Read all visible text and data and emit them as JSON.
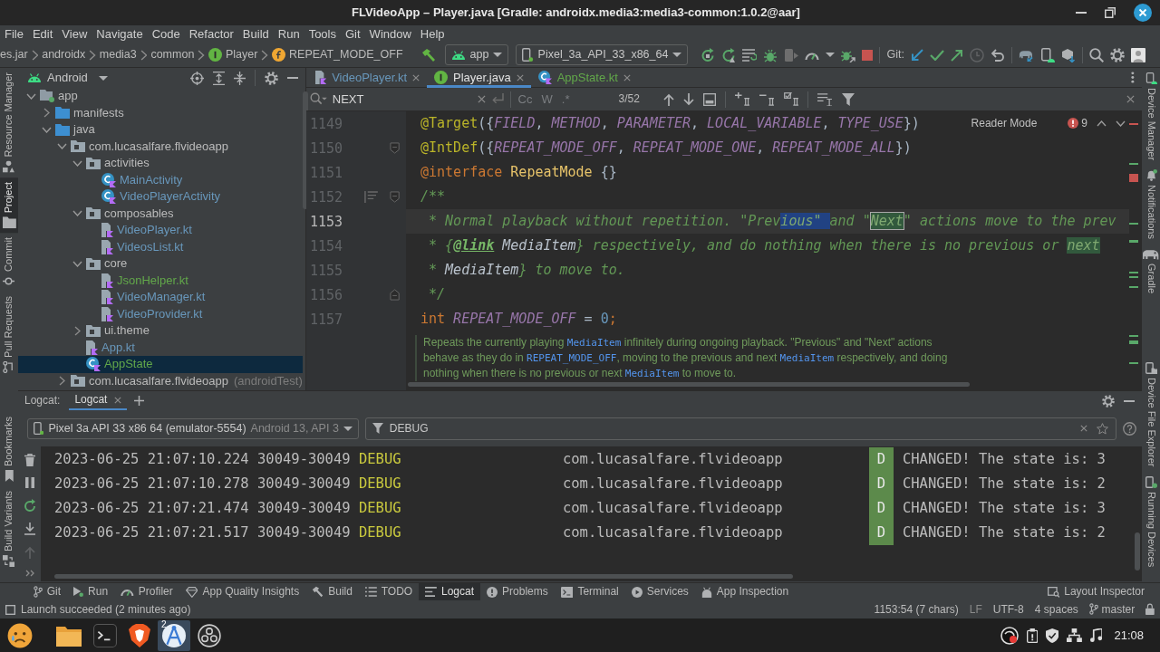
{
  "window": {
    "title": "FLVideoApp – Player.java [Gradle: androidx.media3:media3-common:1.0.2@aar]"
  },
  "menu": [
    "File",
    "Edit",
    "View",
    "Navigate",
    "Code",
    "Refactor",
    "Build",
    "Run",
    "Tools",
    "Git",
    "Window",
    "Help"
  ],
  "breadcrumbs": [
    {
      "label": "es.jar",
      "kind": "package"
    },
    {
      "label": "androidx",
      "kind": "package"
    },
    {
      "label": "media3",
      "kind": "package"
    },
    {
      "label": "common",
      "kind": "package"
    },
    {
      "label": "Player",
      "kind": "interface"
    },
    {
      "label": "REPEAT_MODE_OFF",
      "kind": "field"
    }
  ],
  "run_config": {
    "module": "app",
    "device": "Pixel_3a_API_33_x86_64"
  },
  "vcs_label": "Git:",
  "left_strip_top": [
    {
      "label": "Resource Manager",
      "selected": false
    },
    {
      "label": "Project",
      "selected": true
    },
    {
      "label": "Commit",
      "selected": false
    },
    {
      "label": "Pull Requests",
      "selected": false
    }
  ],
  "left_strip_bottom": [
    {
      "label": "Bookmarks",
      "selected": false
    },
    {
      "label": "Build Variants",
      "selected": false
    }
  ],
  "right_strip_top": [
    {
      "label": "Device Manager",
      "selected": false
    },
    {
      "label": "Notifications",
      "selected": false
    },
    {
      "label": "Gradle",
      "selected": false
    }
  ],
  "right_strip_bottom": [
    {
      "label": "Device File Explorer",
      "selected": false
    },
    {
      "label": "Running Devices",
      "selected": false
    }
  ],
  "project": {
    "view": "Android",
    "tree": [
      {
        "label": "app",
        "kind": "module",
        "modified": false,
        "added": false,
        "expanded": true,
        "selected": false,
        "children": [
          {
            "label": "manifests",
            "kind": "folder",
            "modified": false,
            "added": false,
            "expanded": false,
            "selected": false
          },
          {
            "label": "java",
            "kind": "folder",
            "modified": false,
            "added": false,
            "expanded": true,
            "selected": false,
            "children": [
              {
                "label": "com.lucasalfare.flvideoapp",
                "kind": "package",
                "modified": false,
                "added": false,
                "expanded": true,
                "selected": false,
                "children": [
                  {
                    "label": "activities",
                    "kind": "package",
                    "modified": false,
                    "added": false,
                    "expanded": true,
                    "selected": false,
                    "children": [
                      {
                        "label": "MainActivity",
                        "kind": "class",
                        "modified": true,
                        "added": false,
                        "selected": false
                      },
                      {
                        "label": "VideoPlayerActivity",
                        "kind": "class",
                        "modified": true,
                        "added": false,
                        "selected": false
                      }
                    ]
                  },
                  {
                    "label": "composables",
                    "kind": "package",
                    "modified": false,
                    "added": false,
                    "expanded": true,
                    "selected": false,
                    "children": [
                      {
                        "label": "VideoPlayer.kt",
                        "kind": "kotlin-file",
                        "modified": true,
                        "added": false,
                        "selected": false
                      },
                      {
                        "label": "VideosList.kt",
                        "kind": "kotlin-file",
                        "modified": true,
                        "added": false,
                        "selected": false
                      }
                    ]
                  },
                  {
                    "label": "core",
                    "kind": "package",
                    "modified": false,
                    "added": false,
                    "expanded": true,
                    "selected": false,
                    "children": [
                      {
                        "label": "JsonHelper.kt",
                        "kind": "kotlin-file",
                        "modified": false,
                        "added": true,
                        "selected": false
                      },
                      {
                        "label": "VideoManager.kt",
                        "kind": "kotlin-file",
                        "modified": true,
                        "added": false,
                        "selected": false
                      },
                      {
                        "label": "VideoProvider.kt",
                        "kind": "kotlin-file",
                        "modified": true,
                        "added": false,
                        "selected": false
                      }
                    ]
                  },
                  {
                    "label": "ui.theme",
                    "kind": "package",
                    "modified": false,
                    "added": false,
                    "expanded": false,
                    "selected": false
                  },
                  {
                    "label": "App.kt",
                    "kind": "kotlin-file",
                    "modified": true,
                    "added": false,
                    "selected": false
                  },
                  {
                    "label": "AppState",
                    "kind": "class",
                    "modified": false,
                    "added": true,
                    "selected": true
                  }
                ]
              },
              {
                "label": "com.lucasalfare.flvideoapp",
                "note": "(androidTest)",
                "kind": "package",
                "modified": false,
                "added": false,
                "expanded": false,
                "selected": false
              }
            ]
          }
        ]
      }
    ]
  },
  "editor": {
    "tabs": [
      {
        "label": "VideoPlayer.kt",
        "kind": "kotlin-file",
        "modified": true,
        "added": false,
        "selected": false
      },
      {
        "label": "Player.java",
        "kind": "interface",
        "modified": false,
        "added": false,
        "selected": true
      },
      {
        "label": "AppState.kt",
        "kind": "class",
        "modified": false,
        "added": true,
        "selected": false
      }
    ],
    "find": {
      "value": "NEXT",
      "options": [
        "Cc",
        "W",
        ".*"
      ],
      "count": "3/52"
    },
    "reader_mode": "Reader Mode",
    "problems": "9",
    "lines": [
      {
        "number": "1149",
        "current": false,
        "fold_start": false,
        "fold_end": false,
        "doc_toggle": false,
        "tokens": [
          {
            "text": "@Target",
            "kind": "annotation"
          },
          {
            "text": "({",
            "kind": "punct"
          },
          {
            "text": "FIELD",
            "kind": "constant"
          },
          {
            "text": ", ",
            "kind": "punct"
          },
          {
            "text": "METHOD",
            "kind": "constant"
          },
          {
            "text": ", ",
            "kind": "punct"
          },
          {
            "text": "PARAMETER",
            "kind": "constant"
          },
          {
            "text": ", ",
            "kind": "punct"
          },
          {
            "text": "LOCAL_VARIABLE",
            "kind": "constant"
          },
          {
            "text": ", ",
            "kind": "punct"
          },
          {
            "text": "TYPE_USE",
            "kind": "constant"
          },
          {
            "text": "})",
            "kind": "punct"
          }
        ]
      },
      {
        "number": "1150",
        "current": false,
        "fold_start": true,
        "fold_end": false,
        "doc_toggle": false,
        "tokens": [
          {
            "text": "@IntDef",
            "kind": "annotation"
          },
          {
            "text": "({",
            "kind": "punct"
          },
          {
            "text": "REPEAT_MODE_OFF",
            "kind": "constant"
          },
          {
            "text": ", ",
            "kind": "punct"
          },
          {
            "text": "REPEAT_MODE_ONE",
            "kind": "constant"
          },
          {
            "text": ", ",
            "kind": "punct"
          },
          {
            "text": "REPEAT_MODE_ALL",
            "kind": "constant"
          },
          {
            "text": "})",
            "kind": "punct"
          }
        ]
      },
      {
        "number": "1151",
        "current": false,
        "fold_start": false,
        "fold_end": false,
        "doc_toggle": false,
        "tokens": [
          {
            "text": "@interface",
            "kind": "keyword"
          },
          {
            "text": " RepeatMode",
            "kind": "type"
          },
          {
            "text": " {}",
            "kind": "punct"
          }
        ]
      },
      {
        "number": "1152",
        "current": false,
        "fold_start": true,
        "fold_end": false,
        "doc_toggle": true,
        "tokens": [
          {
            "text": "/**",
            "kind": "comment"
          }
        ]
      },
      {
        "number": "1153",
        "current": true,
        "fold_start": false,
        "fold_end": false,
        "doc_toggle": false,
        "tokens": [
          {
            "text": " * Normal playback without repetition. \"Prev",
            "kind": "comment"
          },
          {
            "text": "ious\" ",
            "kind": "selection"
          },
          {
            "text": "and \"",
            "kind": "comment"
          },
          {
            "text": "Next",
            "kind": "current-match"
          },
          {
            "text": "\" actions move to the prev",
            "kind": "comment"
          }
        ]
      },
      {
        "number": "1154",
        "current": false,
        "fold_start": false,
        "fold_end": false,
        "doc_toggle": false,
        "tokens": [
          {
            "text": " * {",
            "kind": "comment"
          },
          {
            "text": "@link",
            "kind": "doc-tag"
          },
          {
            "text": " MediaItem",
            "kind": "doc-ref"
          },
          {
            "text": "} respectively, and do nothing when there is no previous or ",
            "kind": "comment"
          },
          {
            "text": "next",
            "kind": "match"
          }
        ]
      },
      {
        "number": "1155",
        "current": false,
        "fold_start": false,
        "fold_end": false,
        "doc_toggle": false,
        "tokens": [
          {
            "text": " * ",
            "kind": "comment"
          },
          {
            "text": "MediaItem",
            "kind": "doc-ref"
          },
          {
            "text": "} to move to.",
            "kind": "comment"
          }
        ]
      },
      {
        "number": "1156",
        "current": false,
        "fold_start": false,
        "fold_end": true,
        "doc_toggle": false,
        "tokens": [
          {
            "text": " */",
            "kind": "comment"
          }
        ]
      },
      {
        "number": "1157",
        "current": false,
        "fold_start": false,
        "fold_end": false,
        "doc_toggle": false,
        "tokens": [
          {
            "text": "int",
            "kind": "keyword"
          },
          {
            "text": " REPEAT_MODE_OFF",
            "kind": "constant"
          },
          {
            "text": " = ",
            "kind": "punct"
          },
          {
            "text": "0",
            "kind": "number"
          },
          {
            "text": ";",
            "kind": "keyword"
          }
        ]
      }
    ],
    "rendered_doc": [
      {
        "kind": "text",
        "text": "Repeats the currently playing "
      },
      {
        "kind": "code",
        "text": "MediaItem"
      },
      {
        "kind": "text",
        "text": " infinitely during ongoing playback. \"Previous\" and \"Next\" actions behave as they do in "
      },
      {
        "kind": "code",
        "text": "REPEAT_MODE_OFF"
      },
      {
        "kind": "text",
        "text": ", moving to the previous and next "
      },
      {
        "kind": "code",
        "text": "MediaItem"
      },
      {
        "kind": "text",
        "text": " respectively, and doing nothing when there is no previous or next "
      },
      {
        "kind": "code",
        "text": "MediaItem"
      },
      {
        "kind": "text",
        "text": " to move to."
      }
    ]
  },
  "logcat": {
    "label": "Logcat:",
    "tabs": [
      {
        "label": "Logcat",
        "selected": true
      }
    ],
    "device": "Pixel 3a API 33 x86 64 (emulator-5554)",
    "device_detail": "Android 13, API 3",
    "filter": "DEBUG",
    "rows": [
      {
        "time": "2023-06-25 21:07:10.224",
        "pid": "30049-30049",
        "tag": "DEBUG",
        "package": "com.lucasalfare.flvideoapp",
        "priority": "D",
        "message": "CHANGED! The state is: 3"
      },
      {
        "time": "2023-06-25 21:07:10.278",
        "pid": "30049-30049",
        "tag": "DEBUG",
        "package": "com.lucasalfare.flvideoapp",
        "priority": "D",
        "message": "CHANGED! The state is: 2"
      },
      {
        "time": "2023-06-25 21:07:21.474",
        "pid": "30049-30049",
        "tag": "DEBUG",
        "package": "com.lucasalfare.flvideoapp",
        "priority": "D",
        "message": "CHANGED! The state is: 3"
      },
      {
        "time": "2023-06-25 21:07:21.517",
        "pid": "30049-30049",
        "tag": "DEBUG",
        "package": "com.lucasalfare.flvideoapp",
        "priority": "D",
        "message": "CHANGED! The state is: 2"
      }
    ]
  },
  "tool_windows": [
    {
      "label": "Git",
      "selected": false
    },
    {
      "label": "Run",
      "selected": false
    },
    {
      "label": "Profiler",
      "selected": false
    },
    {
      "label": "App Quality Insights",
      "selected": false
    },
    {
      "label": "Build",
      "selected": false
    },
    {
      "label": "TODO",
      "selected": false
    },
    {
      "label": "Logcat",
      "selected": true
    },
    {
      "label": "Problems",
      "selected": false
    },
    {
      "label": "Terminal",
      "selected": false
    },
    {
      "label": "Services",
      "selected": false
    },
    {
      "label": "App Inspection",
      "selected": false
    }
  ],
  "tool_windows_right": [
    {
      "label": "Layout Inspector",
      "selected": false
    }
  ],
  "status_bar": {
    "message": "Launch succeeded (2 minutes ago)",
    "position": "1153:54 (7 chars)",
    "line_ending": "LF",
    "encoding": "UTF-8",
    "indent": "4 spaces",
    "branch": "master"
  },
  "taskbar": {
    "apps": [
      {
        "selected": false
      },
      {
        "selected": false
      },
      {
        "selected": false
      },
      {
        "selected": false
      },
      {
        "selected": true,
        "badge": "2"
      },
      {
        "selected": false
      }
    ],
    "clock": "21:08"
  }
}
